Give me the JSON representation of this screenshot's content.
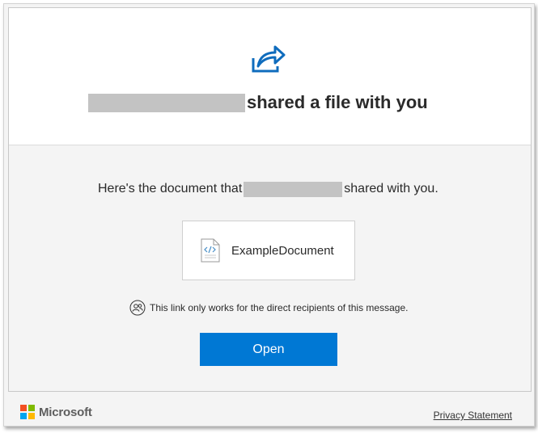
{
  "header": {
    "sender_redacted": true,
    "title_suffix": "shared a file with you",
    "icon": "share-arrow-icon"
  },
  "body": {
    "intro_prefix": "Here's the document that",
    "intro_suffix": "shared with you.",
    "document": {
      "name": "ExampleDocument",
      "icon": "code-file-icon"
    },
    "notice": {
      "icon": "people-icon",
      "text": "This link only works for the direct recipients of this message."
    },
    "open_button_label": "Open"
  },
  "footer": {
    "brand": "Microsoft",
    "privacy_label": "Privacy Statement"
  },
  "colors": {
    "accent": "#0078d4",
    "background": "#f4f4f4",
    "redaction": "#c3c3c3"
  }
}
